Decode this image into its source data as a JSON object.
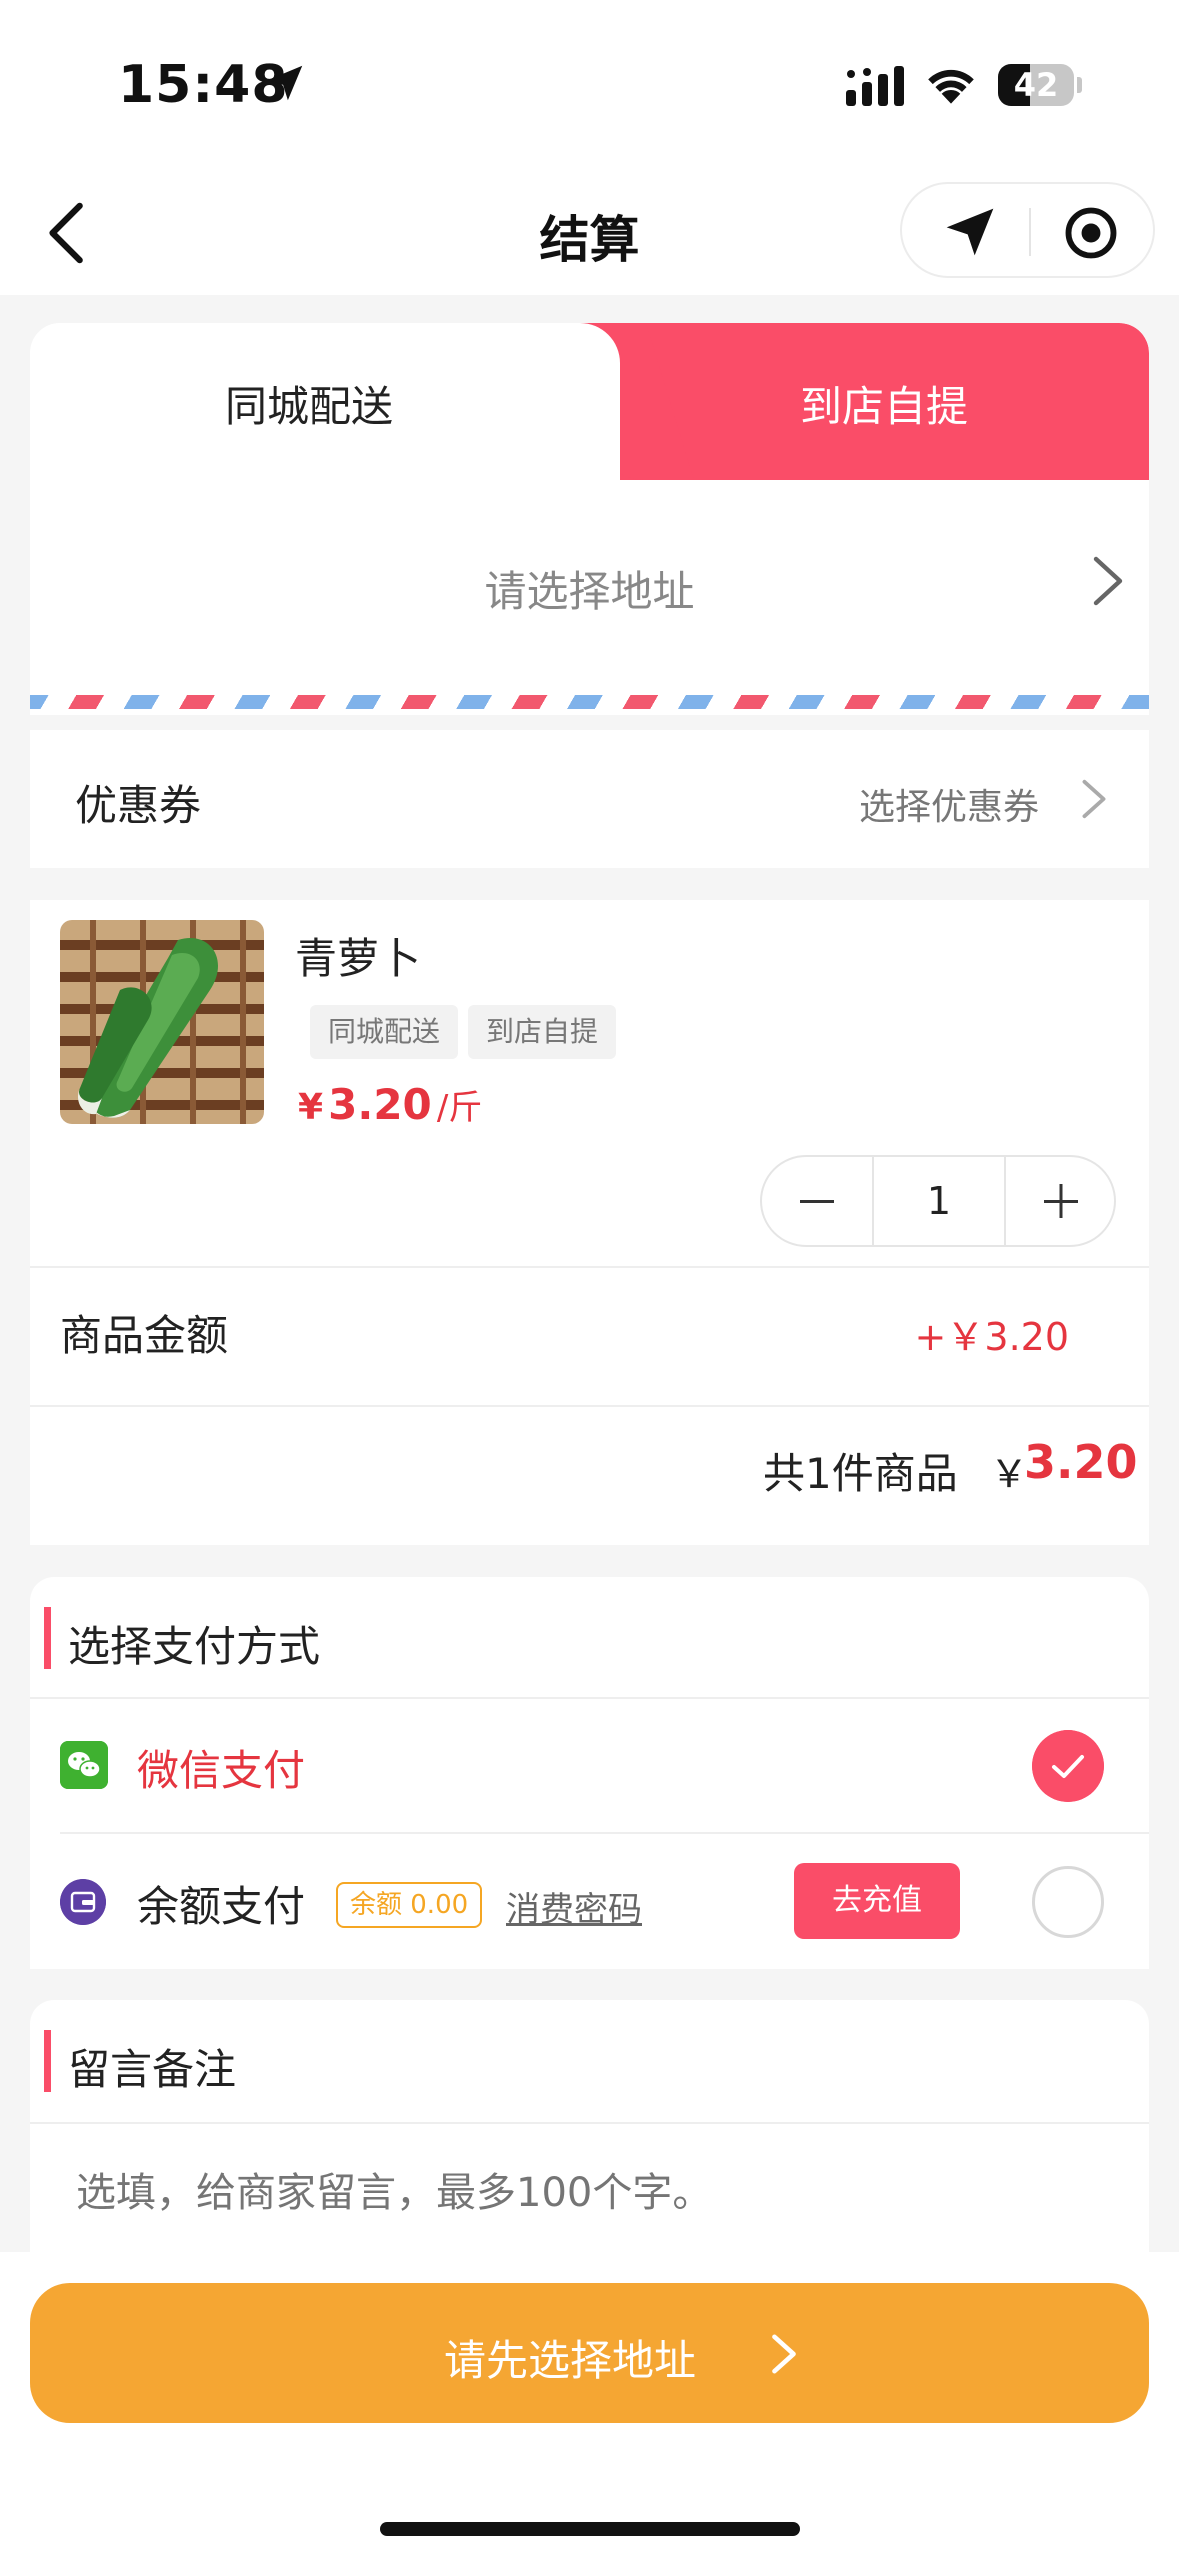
{
  "status_bar": {
    "time": "15:48",
    "battery": "42",
    "battery_level": 0.42
  },
  "nav": {
    "title": "结算"
  },
  "delivery": {
    "tabs": [
      {
        "label": "同城配送",
        "active": false
      },
      {
        "label": "到店自提",
        "active": true
      }
    ],
    "address_placeholder": "请选择地址"
  },
  "coupon": {
    "label": "优惠券",
    "action": "选择优惠券"
  },
  "product": {
    "name": "青萝卜",
    "tags": [
      "同城配送",
      "到店自提"
    ],
    "price_symbol": "¥",
    "price": "3.20",
    "unit": "/斤",
    "quantity": "1"
  },
  "summary": {
    "amount_label": "商品金额",
    "amount_value": "+￥3.20",
    "total_count": "共1件商品",
    "total_symbol": "￥",
    "total_value": "3.20"
  },
  "payment": {
    "title": "选择支付方式",
    "wechat_label": "微信支付",
    "balance_label": "余额支付",
    "balance_tag": "余额 0.00",
    "password_link": "消费密码",
    "recharge_label": "去充值"
  },
  "remark": {
    "title": "留言备注",
    "placeholder": "选填，给商家留言，最多100个字。"
  },
  "submit": {
    "label": "请先选择地址"
  },
  "colors": {
    "accent": "#fa4d68",
    "price": "#e5353f",
    "submit": "#f5a633",
    "balance_tag": "#f5a623",
    "wechat": "#3fb130"
  }
}
